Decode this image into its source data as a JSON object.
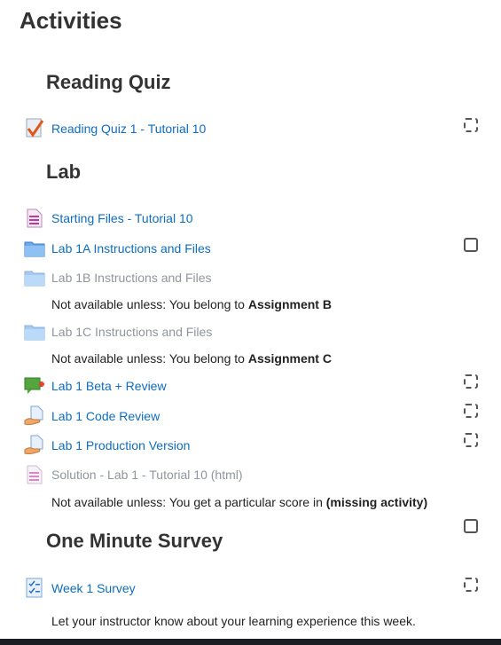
{
  "page": {
    "title": "Activities"
  },
  "sections": {
    "reading_quiz": {
      "title": "Reading Quiz"
    },
    "lab": {
      "title": "Lab"
    },
    "survey": {
      "title": "One Minute Survey"
    }
  },
  "activities": {
    "reading_quiz_1": {
      "label": "Reading Quiz 1 - Tutorial 10",
      "icon": "quiz-icon"
    },
    "starting_files": {
      "label": "Starting Files - Tutorial 10",
      "icon": "page-icon"
    },
    "lab_1a": {
      "label": "Lab 1A Instructions and Files",
      "icon": "folder-icon"
    },
    "lab_1b": {
      "label": "Lab 1B Instructions and Files",
      "icon": "folder-icon",
      "restriction_prefix": "Not available unless: You belong to ",
      "restriction_group": "Assignment B"
    },
    "lab_1c": {
      "label": "Lab 1C Instructions and Files",
      "icon": "folder-icon",
      "restriction_prefix": "Not available unless: You belong to ",
      "restriction_group": "Assignment C"
    },
    "lab_1_beta": {
      "label": "Lab 1 Beta + Review",
      "icon": "workshop-icon"
    },
    "lab_1_code_review": {
      "label": "Lab 1 Code Review",
      "icon": "assignment-icon"
    },
    "lab_1_production": {
      "label": "Lab 1 Production Version",
      "icon": "assignment-icon"
    },
    "solution_lab_1": {
      "label": "Solution - Lab 1 - Tutorial 10 (html)",
      "icon": "page-icon",
      "restriction_prefix": "Not available unless: You get a particular score in ",
      "restriction_target": "(missing activity)"
    },
    "week_1_survey": {
      "label": "Week 1 Survey",
      "icon": "feedback-icon",
      "description": "Let your instructor know about your learning experience this week."
    }
  },
  "colors": {
    "link": "#0f6cbf",
    "dimmed": "#8f959e",
    "text": "#333333"
  }
}
